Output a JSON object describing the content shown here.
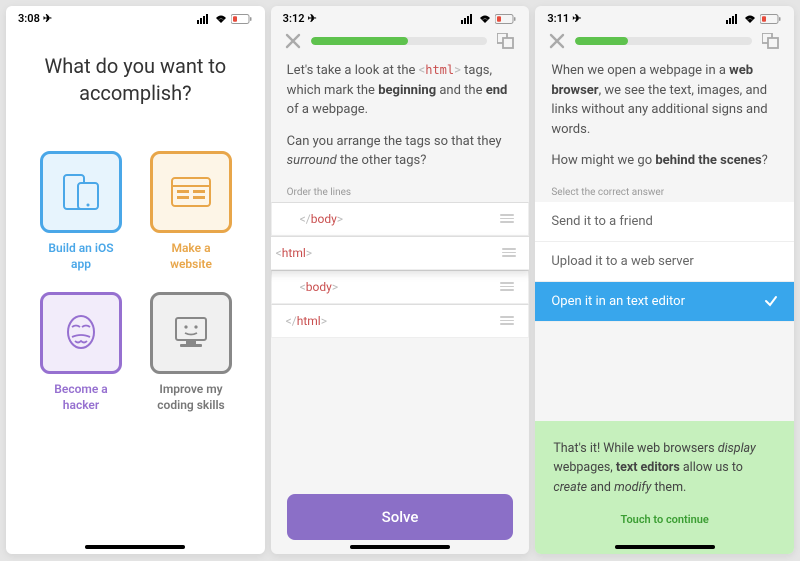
{
  "screen1": {
    "time": "3:08",
    "title": "What do you want to accomplish?",
    "tiles": {
      "0": {
        "label": "Build an iOS app",
        "icon": "phone-tablet-icon"
      },
      "1": {
        "label": "Make a website",
        "icon": "browser-window-icon"
      },
      "2": {
        "label": "Become a hacker",
        "icon": "anonymous-mask-icon"
      },
      "3": {
        "label": "Improve my coding skills",
        "icon": "computer-icon"
      }
    }
  },
  "screen2": {
    "time": "3:12",
    "progress_pct": "55",
    "para1_pre": "Let's take a look at the ",
    "para1_tag": "<html>",
    "para1_post": " tags, which mark the ",
    "para1_b1": "beginning",
    "para1_mid": " and the ",
    "para1_b2": "end",
    "para1_end": " of a webpage.",
    "para2_a": "Can you arrange the tags so that they ",
    "para2_i": "surround",
    "para2_b": " the other tags?",
    "order_label": "Order the lines",
    "lines": {
      "0": "</body>",
      "1": "<html>",
      "2": "<body>",
      "3": "</html>"
    },
    "solve_label": "Solve"
  },
  "screen3": {
    "time": "3:11",
    "progress_pct": "30",
    "para1_a": "When we open a webpage in a ",
    "para1_b": "web browser",
    "para1_c": ", we see the text, images, and links without any additional signs and words.",
    "para2_a": "How might we go ",
    "para2_b": "behind the scenes",
    "para2_c": "?",
    "select_label": "Select the correct answer",
    "answers": {
      "0": "Send it to a friend",
      "1": "Upload it to a web server",
      "2": "Open it in an text editor"
    },
    "feedback_a": "That's it! While web browsers ",
    "feedback_i1": "display",
    "feedback_b": " webpages, ",
    "feedback_bold": "text editors",
    "feedback_c": " allow us to ",
    "feedback_i2": "create",
    "feedback_d": " and ",
    "feedback_i3": "modify",
    "feedback_e": " them.",
    "continue_label": "Touch to continue"
  }
}
